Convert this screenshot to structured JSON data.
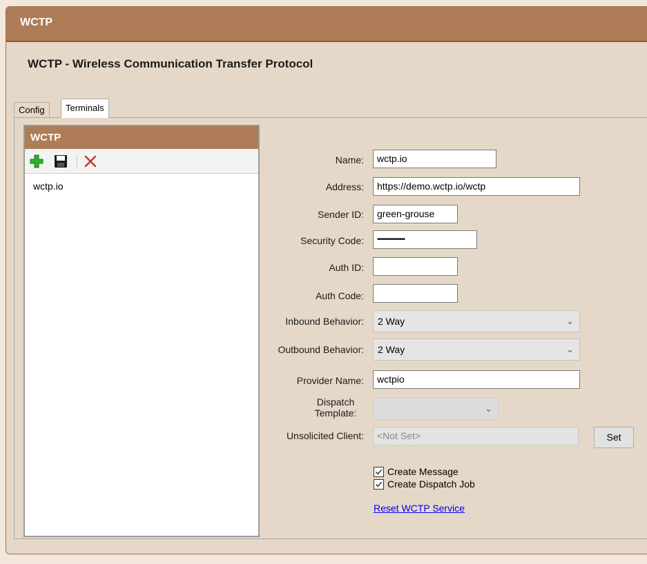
{
  "header": {
    "title": "WCTP"
  },
  "page": {
    "title": "WCTP - Wireless Communication Transfer Protocol"
  },
  "tabs": [
    {
      "label": "Config"
    },
    {
      "label": "Terminals"
    }
  ],
  "list_panel": {
    "title": "WCTP",
    "toolbar": [
      "add-icon",
      "save-icon",
      "delete-icon"
    ],
    "items": [
      {
        "label": "wctp.io"
      }
    ]
  },
  "form": {
    "name": {
      "label": "Name:",
      "value": "wctp.io"
    },
    "address": {
      "label": "Address:",
      "value": "https://demo.wctp.io/wctp"
    },
    "sender_id": {
      "label": "Sender ID:",
      "value": "green-grouse"
    },
    "security_code": {
      "label": "Security Code:",
      "value": "••••••••••••••••"
    },
    "auth_id": {
      "label": "Auth ID:",
      "value": ""
    },
    "auth_code": {
      "label": "Auth Code:",
      "value": ""
    },
    "inbound_behavior": {
      "label": "Inbound Behavior:",
      "value": "2 Way"
    },
    "outbound_behavior": {
      "label": "Outbound Behavior:",
      "value": "2 Way"
    },
    "provider_name": {
      "label": "Provider Name:",
      "value": "wctpio"
    },
    "dispatch_template": {
      "label_line1": "Dispatch",
      "label_line2": "Template:",
      "value": ""
    },
    "unsolicited_client": {
      "label": "Unsolicited Client:",
      "value": "<Not Set>",
      "button": "Set"
    },
    "create_message": {
      "label": "Create Message",
      "checked": true
    },
    "create_dispatch_job": {
      "label": "Create Dispatch Job",
      "checked": true
    },
    "reset_link": "Reset WCTP Service"
  },
  "colors": {
    "header_bg": "#ae7c56",
    "panel_bg": "#e6d8c8",
    "page_bg": "#f1e7dc",
    "add_icon": "#2fae2f",
    "delete_icon": "#c0392b",
    "link": "#0000ee"
  }
}
